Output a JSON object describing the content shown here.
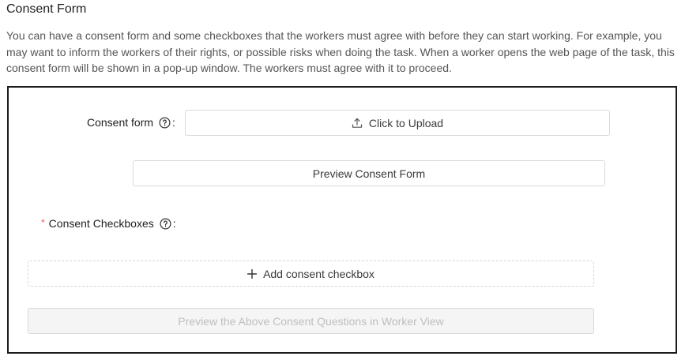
{
  "section": {
    "title": "Consent Form",
    "description": "You can have a consent form and some checkboxes that the workers must agree with before they can start working. For example, you may want to inform the workers of their rights, or possible risks when doing the task. When a worker opens the web page of the task, this consent form will be shown in a pop-up window. The workers must agree with it to proceed."
  },
  "consent_form": {
    "label": "Consent form",
    "colon": ":",
    "upload_label": "Click to Upload",
    "upload_icon": "upload-icon",
    "help_icon": "question-circle-icon",
    "preview_label": "Preview Consent Form"
  },
  "consent_checkboxes": {
    "required_mark": "*",
    "label": "Consent Checkboxes",
    "colon": ":",
    "help_icon": "question-circle-icon",
    "add_label": "Add consent checkbox",
    "add_icon": "plus-icon",
    "preview_worker_label": "Preview the Above Consent Questions in Worker View",
    "preview_worker_disabled": true
  },
  "colors": {
    "panel_border": "#1c1c1c",
    "required": "#ff4d4f",
    "disabled_bg": "#f5f5f5",
    "disabled_text": "#bfbfbf"
  }
}
